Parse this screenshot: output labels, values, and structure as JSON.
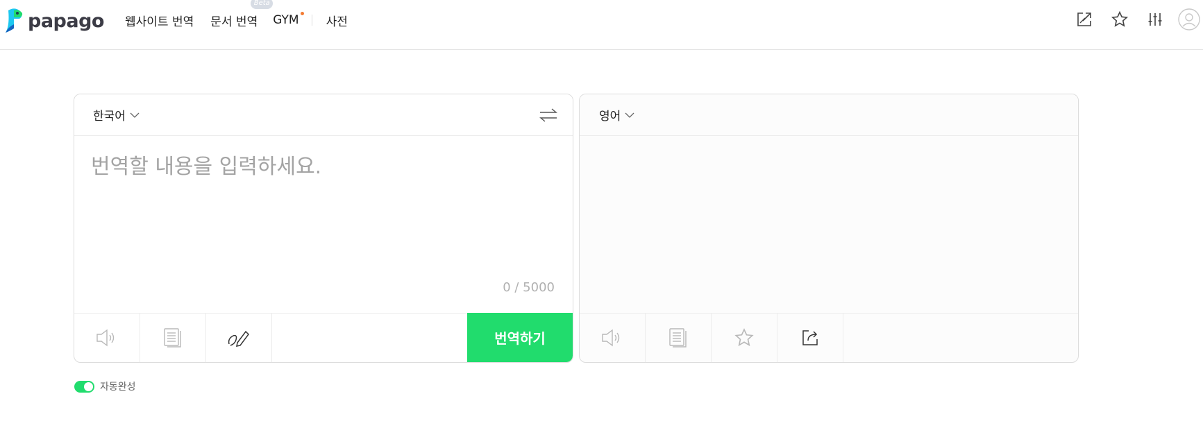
{
  "header": {
    "logo_text": "papago",
    "nav": {
      "website_translation": "웹사이트 번역",
      "document_translation": "문서 번역",
      "beta_badge": "Beta",
      "gym": "GYM",
      "dictionary": "사전"
    },
    "icons": [
      "share-window-icon",
      "star-icon",
      "settings-sliders-icon",
      "user-avatar-icon"
    ]
  },
  "source": {
    "language": "한국어",
    "placeholder": "번역할 내용을 입력하세요.",
    "value": "",
    "char_count": "0 / 5000",
    "tools": [
      "speaker-icon",
      "copy-icon",
      "handwriting-icon"
    ],
    "translate_label": "번역하기"
  },
  "target": {
    "language": "영어",
    "result": "",
    "tools": [
      "speaker-icon",
      "copy-icon",
      "star-icon",
      "share-icon"
    ]
  },
  "autocomplete": {
    "label": "자동완성",
    "enabled": true
  },
  "colors": {
    "accent": "#21dc6d",
    "gym_dot": "#f47b32"
  }
}
